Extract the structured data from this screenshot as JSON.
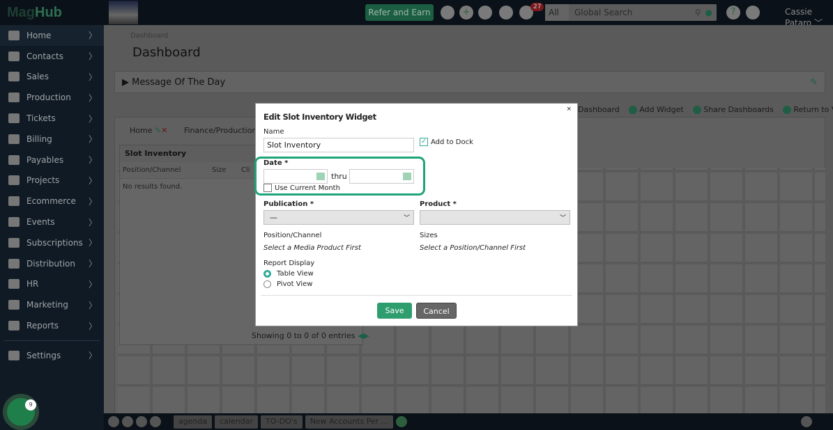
{
  "topbar": {
    "logo_a": "Mag",
    "logo_b": "Hub",
    "refer": "Refer and Earn",
    "notifications": "27",
    "search_scope": "All",
    "search_placeholder": "Global Search",
    "user": "Cassie Pataro"
  },
  "sidebar": {
    "items": [
      {
        "label": "Home"
      },
      {
        "label": "Contacts"
      },
      {
        "label": "Sales"
      },
      {
        "label": "Production"
      },
      {
        "label": "Tickets"
      },
      {
        "label": "Billing"
      },
      {
        "label": "Payables"
      },
      {
        "label": "Projects"
      },
      {
        "label": "Ecommerce"
      },
      {
        "label": "Events"
      },
      {
        "label": "Subscriptions"
      },
      {
        "label": "Distribution"
      },
      {
        "label": "HR"
      },
      {
        "label": "Marketing"
      },
      {
        "label": "Reports"
      }
    ],
    "settings": "Settings",
    "chevron": "〉"
  },
  "main": {
    "breadcrumb": "Dashboard",
    "title": "Dashboard",
    "motd": "Message Of The Day",
    "actions": {
      "dashboard": "Dashboard",
      "add_widget": "Add Widget",
      "share": "Share Dashboards",
      "return": "Return to View"
    },
    "tabs": [
      "Home",
      "Finance/Production"
    ],
    "widget": {
      "title": "Slot Inventory",
      "columns": [
        "Position/Channel",
        "Size",
        "Cli"
      ],
      "empty": "No results found.",
      "showing": "Showing 0 to 0 of 0 entries"
    }
  },
  "bottombar": {
    "tabs": [
      "agenda",
      "calendar",
      "TO-DO's",
      "New Accounts Per ..."
    ],
    "fab_count": "9"
  },
  "modal": {
    "title": "Edit Slot Inventory Widget",
    "close": "×",
    "name_label": "Name",
    "name_value": "Slot Inventory",
    "add_to_dock": "Add to Dock",
    "add_to_dock_checked": true,
    "date_label": "Date *",
    "thru": "thru",
    "use_current_month": "Use Current Month",
    "use_current_month_checked": false,
    "publication_label": "Publication *",
    "publication_value": "—",
    "product_label": "Product *",
    "product_value": "",
    "position_label": "Position/Channel",
    "position_hint": "Select a Media Product First",
    "sizes_label": "Sizes",
    "sizes_hint": "Select a Position/Channel First",
    "report_display_label": "Report Display",
    "options": [
      "Table View",
      "Pivot View"
    ],
    "selected_option": "Table View",
    "save": "Save",
    "cancel": "Cancel"
  },
  "colors": {
    "accent": "#2f9e6e",
    "highlight": "#1fa47a",
    "cancel": "#666666"
  }
}
